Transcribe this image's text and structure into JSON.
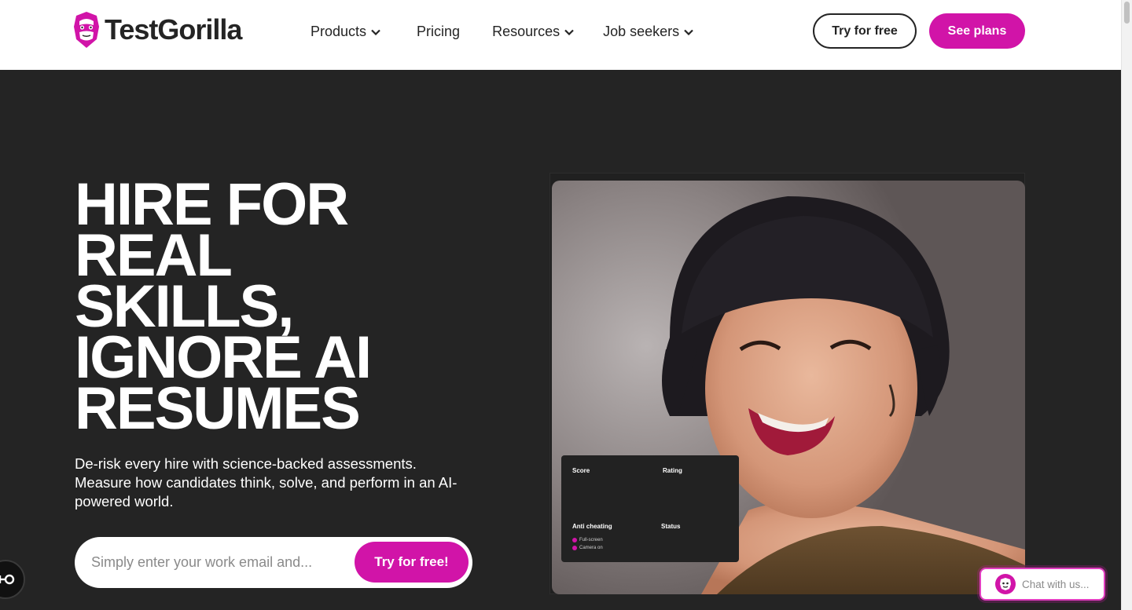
{
  "header": {
    "brand": "TestGorilla",
    "nav": [
      {
        "label": "Products",
        "has_dropdown": true
      },
      {
        "label": "Pricing",
        "has_dropdown": false
      },
      {
        "label": "Resources",
        "has_dropdown": true
      },
      {
        "label": "Job seekers",
        "has_dropdown": true
      }
    ],
    "try_free_label": "Try for free",
    "see_plans_label": "See plans"
  },
  "hero": {
    "title_lines": [
      "HIRE FOR",
      "REAL",
      "SKILLS,",
      "IGNORE AI",
      "RESUMES"
    ],
    "subtitle": "De-risk every hire with science-backed assessments. Measure how candidates think, solve, and perform in an AI-powered world.",
    "email_placeholder": "Simply enter your work email and...",
    "cta_label": "Try for free!"
  },
  "score_card": {
    "score_label": "Score",
    "rating_label": "Rating",
    "anti_cheating_label": "Anti cheating",
    "status_label": "Status",
    "checks": [
      "Full-screen",
      "Camera on"
    ]
  },
  "chat": {
    "label": "Chat with us..."
  },
  "colors": {
    "brand_pink": "#d114a8",
    "hero_bg": "#242424",
    "header_bg": "#ffffff"
  },
  "icons": {
    "logo": "gorilla-logo-icon",
    "dropdown": "chevron-down-icon",
    "accessibility": "accessibility-icon",
    "chat": "chat-bot-icon"
  }
}
